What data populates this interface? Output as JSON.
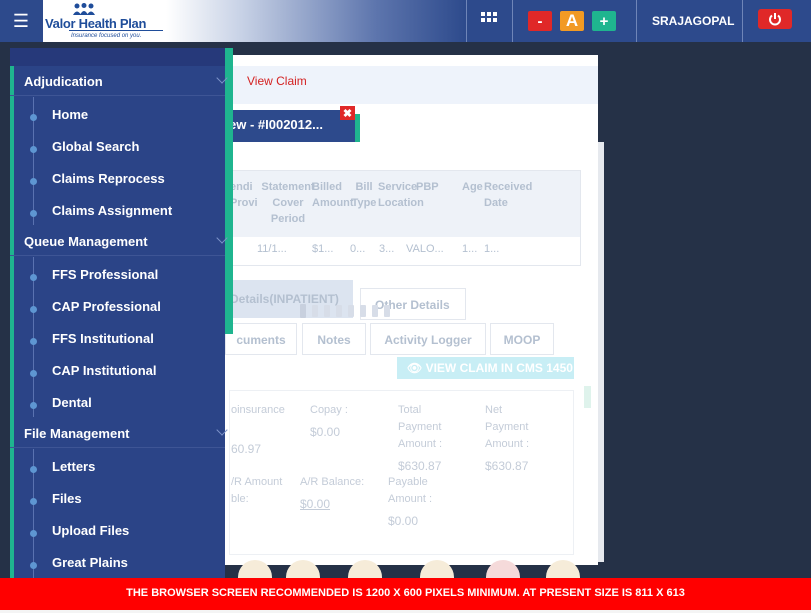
{
  "header": {
    "logo_text": "Valor Health Plan",
    "logo_tagline": "Insurance focused on you.",
    "user": "SRAJAGOPAL",
    "zoom_out": "-",
    "font_size": "A",
    "zoom_in": "+"
  },
  "breadcrumb": "View Claim",
  "claim_tab": "ew - #I002012...",
  "table": {
    "headers": [
      "endi Provide",
      "Statement Cover Period",
      "Billed Amount",
      "Bill Type",
      "Service Location",
      "PBP",
      "Age",
      "Received Date"
    ],
    "row": [
      "11/1...",
      "$1...",
      "0...",
      "3...",
      "VALO...",
      "1...",
      "1..."
    ]
  },
  "tabs": {
    "details": "Details(INPATIENT)",
    "other": "Other Details",
    "documents": "cuments",
    "notes": "Notes",
    "activity": "Activity Logger",
    "moop": "MOOP"
  },
  "view_cms": "VIEW CLAIM IN CMS 1450",
  "amounts": {
    "coins_label": "oinsurance",
    "coins_value": "60.97",
    "copay_label": "Copay :",
    "copay_value": "$0.00",
    "total_label": "Total Payment Amount :",
    "total_value": "$630.87",
    "net_label": "Net Payment Amount :",
    "net_value": "$630.87",
    "ar_amount_label": "/R Amount ble:",
    "ar_balance_label": "A/R Balance:",
    "ar_balance_value": "$0.00",
    "payable_label": "Payable Amount :",
    "payable_value": "$0.00"
  },
  "sidebar": {
    "sections": [
      {
        "title": "Adjudication",
        "items": [
          "Home",
          "Global Search",
          "Claims Reprocess",
          "Claims Assignment"
        ]
      },
      {
        "title": "Queue Management",
        "items": [
          "FFS Professional",
          "CAP Professional",
          "FFS Institutional",
          "CAP Institutional",
          "Dental"
        ]
      },
      {
        "title": "File Management",
        "items": [
          "Letters",
          "Files",
          "Upload Files",
          "Great Plains"
        ]
      }
    ]
  },
  "warning": "THE BROWSER SCREEN RECOMMENDED IS 1200 X 600 PIXELS MINIMUM. AT PRESENT SIZE IS 811 X 613",
  "colors": {
    "brand": "#2d4a8c",
    "accent": "#1fb58f",
    "danger": "#ff0000"
  }
}
